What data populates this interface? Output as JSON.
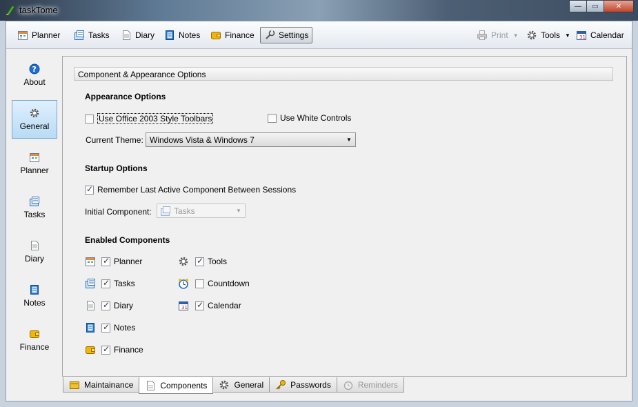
{
  "window": {
    "title": "taskTome"
  },
  "toolbar": {
    "left": [
      {
        "label": "Planner",
        "icon": "planner-icon"
      },
      {
        "label": "Tasks",
        "icon": "tasks-icon"
      },
      {
        "label": "Diary",
        "icon": "diary-icon"
      },
      {
        "label": "Notes",
        "icon": "notes-icon"
      },
      {
        "label": "Finance",
        "icon": "finance-icon"
      },
      {
        "label": "Settings",
        "icon": "settings-icon",
        "active": true
      }
    ],
    "right": [
      {
        "label": "Print",
        "icon": "print-icon",
        "disabled": true
      },
      {
        "label": "Tools",
        "icon": "gear-icon"
      },
      {
        "label": "Calendar",
        "icon": "calendar-icon"
      }
    ]
  },
  "sidebar": {
    "items": [
      {
        "label": "About",
        "icon": "help-icon"
      },
      {
        "label": "General",
        "icon": "gear-icon",
        "active": true
      },
      {
        "label": "Planner",
        "icon": "planner-icon"
      },
      {
        "label": "Tasks",
        "icon": "tasks-icon"
      },
      {
        "label": "Diary",
        "icon": "diary-icon"
      },
      {
        "label": "Notes",
        "icon": "notes-icon"
      },
      {
        "label": "Finance",
        "icon": "finance-icon"
      }
    ]
  },
  "panel": {
    "header": "Component & Appearance Options",
    "appearance": {
      "title": "Appearance Options",
      "office_toolbars": {
        "label": "Use Office 2003 Style Toolbars",
        "checked": false
      },
      "white_controls": {
        "label": "Use White Controls",
        "checked": false
      },
      "theme_label": "Current Theme:",
      "theme_value": "Windows Vista & Windows 7"
    },
    "startup": {
      "title": "Startup Options",
      "remember": {
        "label": "Remember Last Active Component Between Sessions",
        "checked": true
      },
      "initial_label": "Initial Component:",
      "initial_value": "Tasks"
    },
    "enabled": {
      "title": "Enabled Components",
      "left": [
        {
          "label": "Planner",
          "checked": true
        },
        {
          "label": "Tasks",
          "checked": true
        },
        {
          "label": "Diary",
          "checked": true
        },
        {
          "label": "Notes",
          "checked": true
        },
        {
          "label": "Finance",
          "checked": true
        }
      ],
      "right": [
        {
          "label": "Tools",
          "checked": true
        },
        {
          "label": "Countdown",
          "checked": false
        },
        {
          "label": "Calendar",
          "checked": true
        }
      ]
    }
  },
  "tabs": [
    {
      "label": "Maintainance"
    },
    {
      "label": "Components",
      "active": true
    },
    {
      "label": "General"
    },
    {
      "label": "Passwords"
    },
    {
      "label": "Reminders",
      "disabled": true
    }
  ],
  "colors": {
    "selection": "#b9dbf5",
    "selection_border": "#6ea7d6",
    "panel_bg": "#f0f0f0"
  }
}
